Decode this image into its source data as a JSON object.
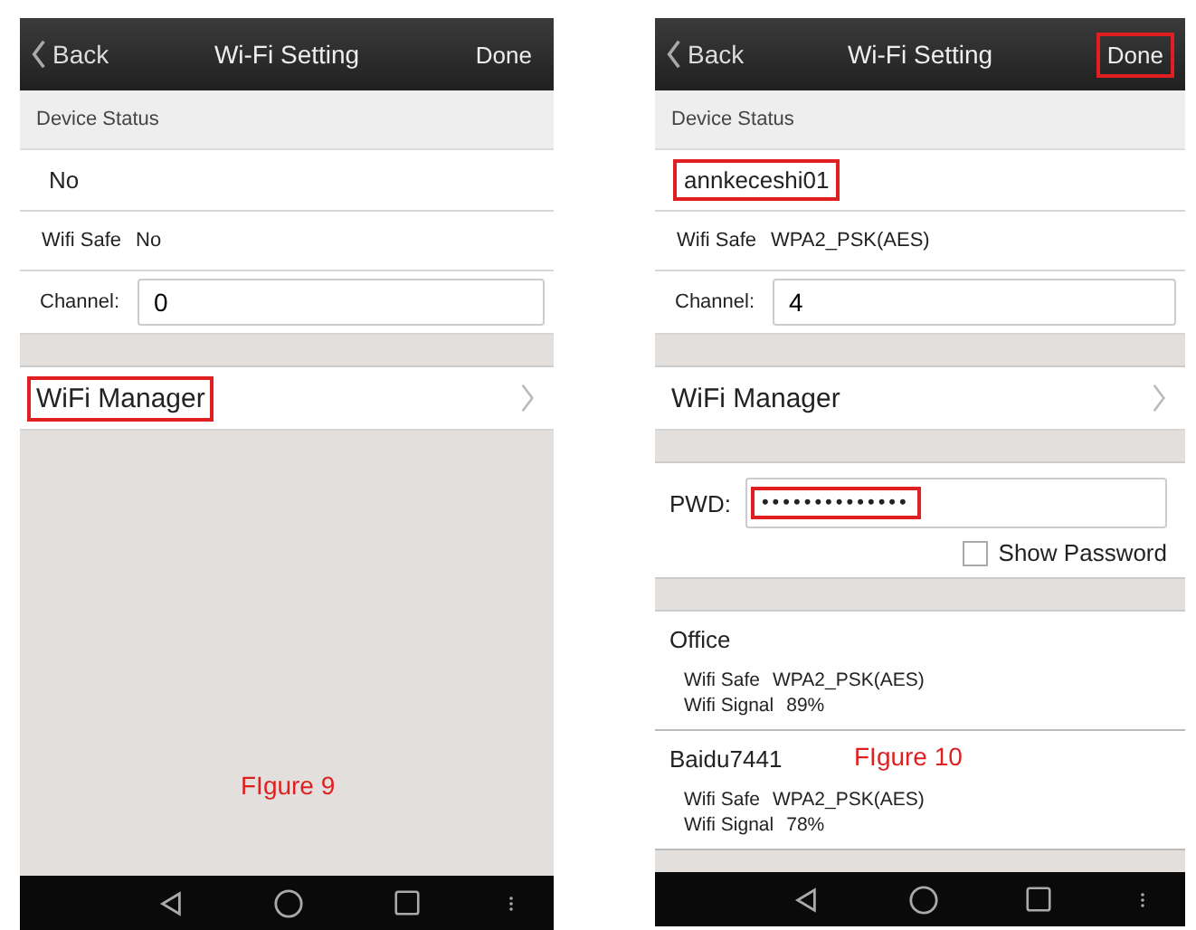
{
  "screens": [
    {
      "header": {
        "back": "Back",
        "title": "Wi-Fi Setting",
        "done": {
          "label": "Done",
          "highlighted": false
        }
      },
      "section_label": "Device Status",
      "device_name": {
        "text": "No",
        "highlighted": false
      },
      "wifi_safe": {
        "label": "Wifi Safe",
        "value": "No"
      },
      "channel": {
        "label": "Channel:",
        "value": "0"
      },
      "wifi_manager": {
        "label": "WiFi Manager",
        "highlighted": true
      },
      "caption": "FIgure 9"
    },
    {
      "header": {
        "back": "Back",
        "title": "Wi-Fi Setting",
        "done": {
          "label": "Done",
          "highlighted": true
        }
      },
      "section_label": "Device Status",
      "device_name": {
        "text": "annkeceshi01",
        "highlighted": true
      },
      "wifi_safe": {
        "label": "Wifi Safe",
        "value": "WPA2_PSK(AES)"
      },
      "channel": {
        "label": "Channel:",
        "value": "4"
      },
      "wifi_manager": {
        "label": "WiFi Manager",
        "highlighted": false
      },
      "password": {
        "label": "PWD:",
        "value": "••••••••••••••",
        "highlighted": true,
        "show_password": {
          "label": "Show Password",
          "checked": false
        }
      },
      "networks": [
        {
          "name": "Office",
          "safe_label": "Wifi Safe",
          "safe": "WPA2_PSK(AES)",
          "signal_label": "Wifi Signal",
          "signal": "89%"
        },
        {
          "name": "Baidu7441",
          "safe_label": "Wifi Safe",
          "safe": "WPA2_PSK(AES)",
          "signal_label": "Wifi Signal",
          "signal": "78%"
        }
      ],
      "caption": "FIgure 10"
    }
  ]
}
